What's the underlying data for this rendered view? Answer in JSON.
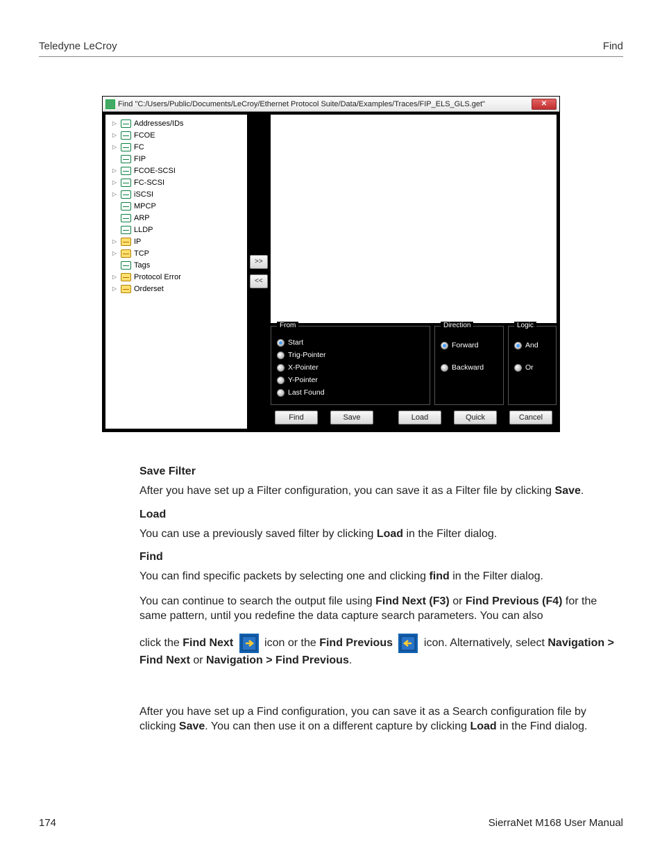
{
  "header": {
    "left": "Teledyne LeCroy",
    "right": "Find"
  },
  "window": {
    "title": "Find \"C:/Users/Public/Documents/LeCroy/Ethernet Protocol Suite/Data/Examples/Traces/FIP_ELS_GLS.get\"",
    "close_label": "✕",
    "tree": [
      {
        "label": "Addresses/IDs",
        "expander": true,
        "highlight": false
      },
      {
        "label": "FCOE",
        "expander": true,
        "highlight": false
      },
      {
        "label": "FC",
        "expander": true,
        "highlight": false
      },
      {
        "label": "FIP",
        "expander": false,
        "highlight": false
      },
      {
        "label": "FCOE-SCSI",
        "expander": true,
        "highlight": false
      },
      {
        "label": "FC-SCSI",
        "expander": true,
        "highlight": false
      },
      {
        "label": "iSCSI",
        "expander": true,
        "highlight": false
      },
      {
        "label": "MPCP",
        "expander": false,
        "highlight": false
      },
      {
        "label": "ARP",
        "expander": false,
        "highlight": false
      },
      {
        "label": "LLDP",
        "expander": false,
        "highlight": false
      },
      {
        "label": "IP",
        "expander": true,
        "highlight": true
      },
      {
        "label": "TCP",
        "expander": true,
        "highlight": true
      },
      {
        "label": "Tags",
        "expander": false,
        "highlight": false
      },
      {
        "label": "Protocol Error",
        "expander": true,
        "highlight": true
      },
      {
        "label": "Orderset",
        "expander": true,
        "highlight": true
      }
    ],
    "move_add": ">>",
    "move_remove": "<<",
    "from": {
      "legend": "From",
      "options": [
        {
          "label": "Start",
          "checked": true
        },
        {
          "label": "Trig-Pointer",
          "checked": false
        },
        {
          "label": "X-Pointer",
          "checked": false
        },
        {
          "label": "Y-Pointer",
          "checked": false
        },
        {
          "label": "Last Found",
          "checked": false
        }
      ]
    },
    "direction": {
      "legend": "Direction",
      "options": [
        {
          "label": "Forward",
          "checked": true
        },
        {
          "label": "Backward",
          "checked": false
        }
      ]
    },
    "logic": {
      "legend": "Logic",
      "options": [
        {
          "label": "And",
          "checked": true
        },
        {
          "label": "Or",
          "checked": false
        }
      ]
    },
    "buttons": {
      "find": "Find",
      "save": "Save",
      "load": "Load",
      "quick": "Quick",
      "cancel": "Cancel"
    }
  },
  "doc": {
    "save_filter_h": "Save Filter",
    "save_filter_p1a": "After you have set up a Filter configuration, you can save it as a Filter file by clicking ",
    "save_filter_p1b": "Save",
    "save_filter_p1c": ".",
    "load_h": "Load",
    "load_p1a": "You can use a previously saved filter by clicking ",
    "load_p1b": "Load",
    "load_p1c": " in the Filter dialog.",
    "find_h": "Find",
    "find_p1a": "You can find specific packets by selecting one and clicking ",
    "find_p1b": "find",
    "find_p1c": " in the Filter dialog.",
    "find_p2a": "You can continue to search the output file using ",
    "find_p2b": "Find Next (F3)",
    "find_p2c": " or ",
    "find_p2d": "Find Previous (F4)",
    "find_p2e": " for the same pattern, until you redefine the data capture search parameters. You can also",
    "find_p3a": "click the ",
    "find_p3b": "Find Next",
    "find_p3c": " icon or the ",
    "find_p3d": "Find Previous",
    "find_p3e": " icon. Alternatively, select ",
    "find_p3f": "Navigation > Find Next",
    "find_p3g": " or ",
    "find_p3h": "Navigation > Find Previous",
    "find_p3i": ".",
    "find_p4a": "After you have set up a Find configuration, you can save it as a Search configuration file by clicking ",
    "find_p4b": "Save",
    "find_p4c": ". You can then use it on a different capture by clicking ",
    "find_p4d": "Load",
    "find_p4e": " in the Find dialog."
  },
  "footer": {
    "page": "174",
    "manual": "SierraNet M168 User Manual"
  }
}
